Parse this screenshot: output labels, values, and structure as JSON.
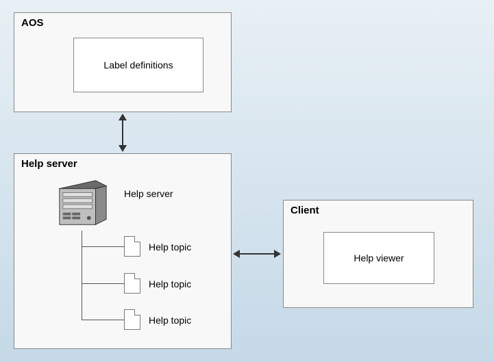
{
  "aos": {
    "title": "AOS",
    "box_label": "Label definitions"
  },
  "help_server": {
    "title": "Help server",
    "server_label": "Help server",
    "topics": [
      "Help topic",
      "Help topic",
      "Help topic"
    ]
  },
  "client": {
    "title": "Client",
    "box_label": "Help viewer"
  }
}
